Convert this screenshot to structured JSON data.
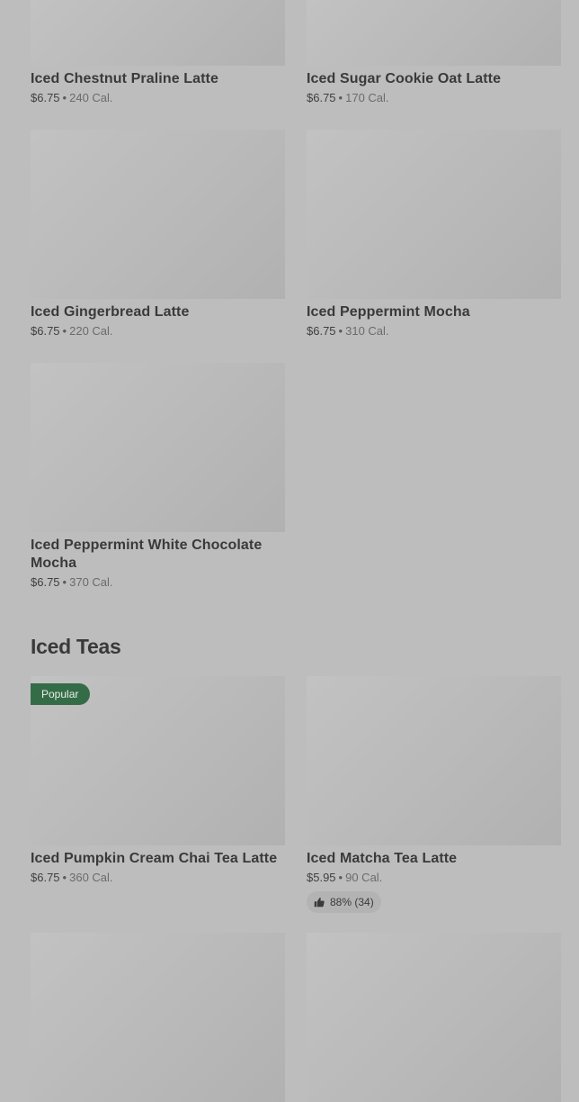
{
  "colors": {
    "background": "#bdbdbd",
    "image_placeholder": "#b9b9b9",
    "popular_badge": "#356c48",
    "rating_chip": "#b3b3b3"
  },
  "separator": "•",
  "sections": {
    "iced_lattes_continued": {
      "items": [
        {
          "name": "Iced Chestnut Praline Latte",
          "price": "$6.75",
          "calories": "240 Cal."
        },
        {
          "name": "Iced Sugar Cookie Oat Latte",
          "price": "$6.75",
          "calories": "170 Cal."
        },
        {
          "name": "Iced Gingerbread Latte",
          "price": "$6.75",
          "calories": "220 Cal."
        },
        {
          "name": "Iced Peppermint Mocha",
          "price": "$6.75",
          "calories": "310 Cal."
        },
        {
          "name": "Iced Peppermint White Chocolate Mocha",
          "price": "$6.75",
          "calories": "370 Cal."
        }
      ]
    },
    "iced_teas": {
      "title": "Iced Teas",
      "items": [
        {
          "name": "Iced Pumpkin Cream Chai Tea Latte",
          "price": "$6.75",
          "calories": "360 Cal.",
          "badge": "Popular"
        },
        {
          "name": "Iced Matcha Tea Latte",
          "price": "$5.95",
          "calories": "90 Cal.",
          "rating": "88% (34)",
          "rating_icon": "thumbs-up-icon"
        }
      ]
    }
  }
}
